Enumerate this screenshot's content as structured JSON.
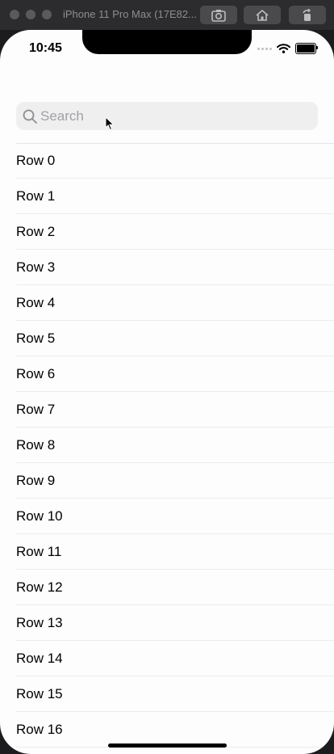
{
  "simulator": {
    "title": "iPhone 11 Pro Max (17E82..."
  },
  "status_bar": {
    "time": "10:45"
  },
  "search": {
    "placeholder": "Search"
  },
  "rows": [
    "Row 0",
    "Row 1",
    "Row 2",
    "Row 3",
    "Row 4",
    "Row 5",
    "Row 6",
    "Row 7",
    "Row 8",
    "Row 9",
    "Row 10",
    "Row 11",
    "Row 12",
    "Row 13",
    "Row 14",
    "Row 15",
    "Row 16"
  ],
  "colors": {
    "background": "#fdfdfd",
    "search_field": "#efeff0",
    "placeholder": "#a1a1a6",
    "separator": "#e5e5ea"
  }
}
